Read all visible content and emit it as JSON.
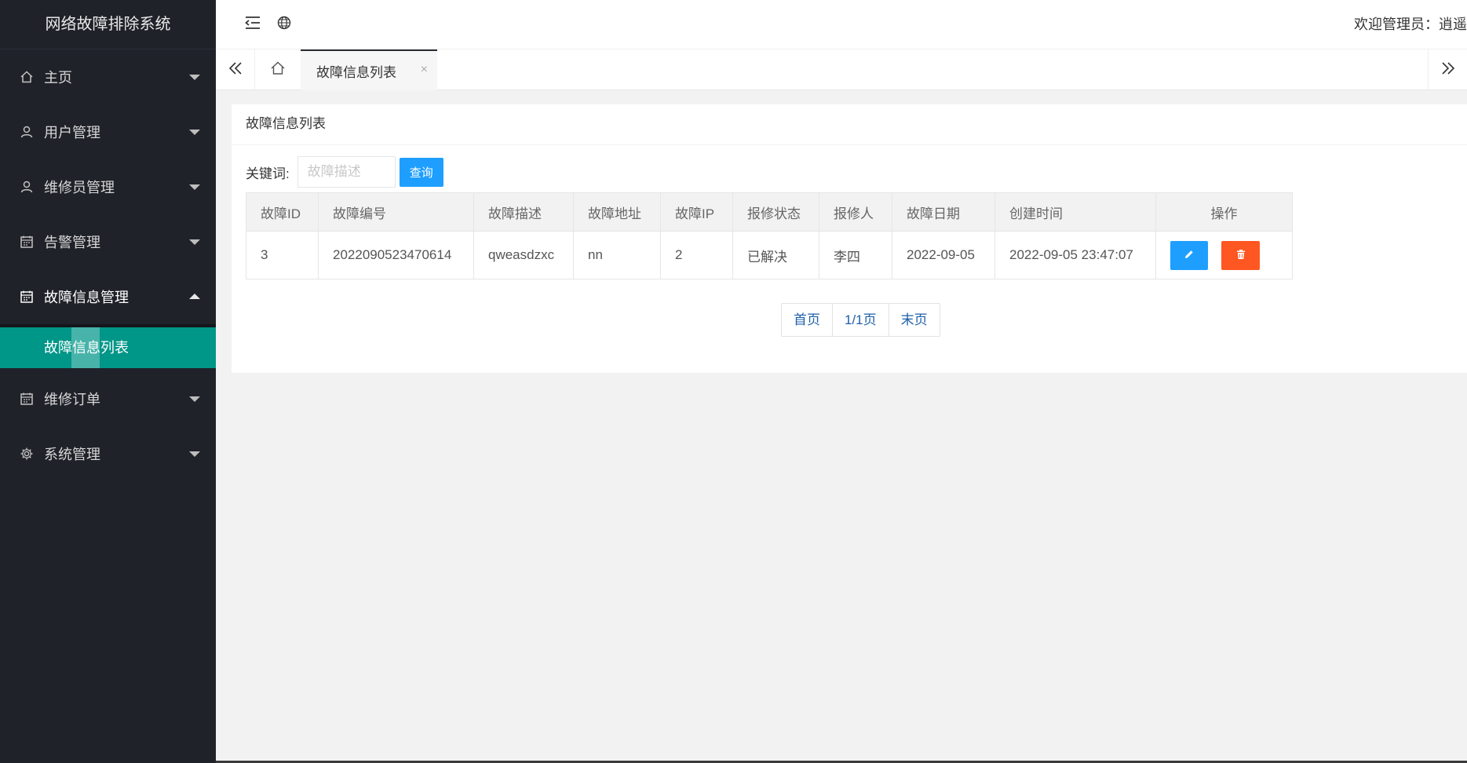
{
  "app": {
    "title": "网络故障排除系统",
    "welcome": "欢迎管理员：逍遥"
  },
  "sidebar": {
    "items": [
      {
        "label": "主页",
        "icon": "home-icon"
      },
      {
        "label": "用户管理",
        "icon": "user-icon"
      },
      {
        "label": "维修员管理",
        "icon": "user-icon"
      },
      {
        "label": "告警管理",
        "icon": "calendar-icon"
      },
      {
        "label": "故障信息管理",
        "icon": "calendar-icon",
        "open": true
      },
      {
        "label": "维修订单",
        "icon": "calendar-icon"
      },
      {
        "label": "系统管理",
        "icon": "gear-icon"
      }
    ],
    "submenu": {
      "label": "故障信息列表"
    }
  },
  "tabs": {
    "active": "故障信息列表",
    "close": "×"
  },
  "main": {
    "card_title": "故障信息列表",
    "search": {
      "label": "关键词:",
      "placeholder": "故障描述",
      "button": "查询"
    },
    "table": {
      "columns": [
        "故障ID",
        "故障编号",
        "故障描述",
        "故障地址",
        "故障IP",
        "报修状态",
        "报修人",
        "故障日期",
        "创建时间",
        "操作"
      ],
      "rows": [
        {
          "id": "3",
          "code": "2022090523470614",
          "desc": "qweasdzxc",
          "addr": "nn",
          "ip": "2",
          "status": "已解决",
          "reporter": "李四",
          "date": "2022-09-05",
          "created": "2022-09-05 23:47:07"
        }
      ]
    },
    "pager": {
      "first": "首页",
      "current": "1/1页",
      "last": "末页"
    }
  },
  "colors": {
    "sidebar_bg": "#20222a",
    "accent": "#009688",
    "primary_button": "#1e9fff",
    "danger_button": "#ff5722",
    "status_ok": "#5fb878"
  }
}
